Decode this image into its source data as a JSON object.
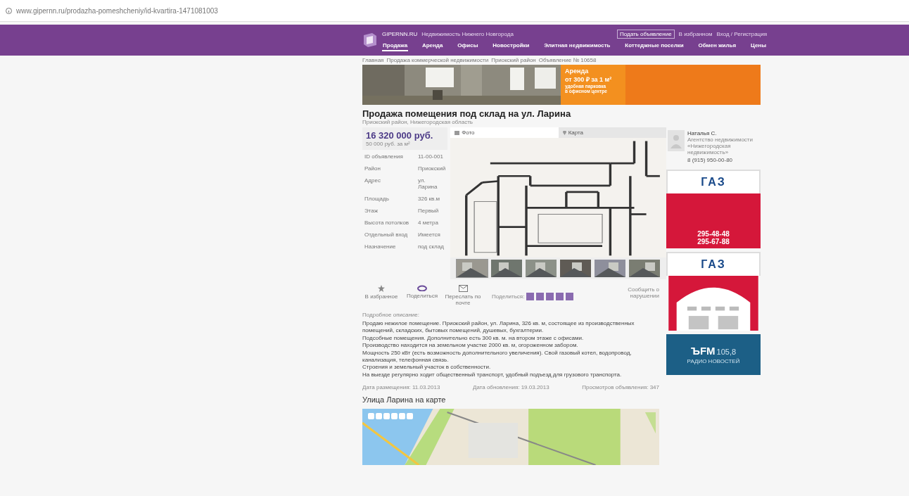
{
  "address_bar": {
    "url": "www.gipernn.ru/prodazha-pomeshcheniy/id-kvartira-1471081003"
  },
  "header": {
    "site_name": "GIPERNN.RU",
    "tagline": "Недвижимость Нижнего Новгорода",
    "post_button": "Подать объявление",
    "favorites": "В избранном",
    "login": "Вход / Регистрация",
    "nav": [
      {
        "label": "Продажа",
        "selected": true
      },
      {
        "label": "Аренда",
        "selected": false
      },
      {
        "label": "Офисы",
        "selected": false
      },
      {
        "label": "Новостройки",
        "selected": false
      },
      {
        "label": "Элитная недвижимость",
        "selected": false
      },
      {
        "label": "Коттеджные поселки",
        "selected": false
      },
      {
        "label": "Обмен жилья",
        "selected": false
      },
      {
        "label": "Цены",
        "selected": false
      }
    ]
  },
  "breadcrumbs": [
    "Главная",
    "Продажа коммерческой недвижимости",
    "Приокский район",
    "Объявление № 10658"
  ],
  "banner": {
    "lines": [
      "Аренда",
      "от 300 ₽ за 1 м²",
      "удобная парковка",
      "в офисном центре"
    ]
  },
  "listing": {
    "title": "Продажа помещения под склад на ул. Ларина",
    "subtitle": "Приокский район, Нижегородская область",
    "price": "16 320 000 руб.",
    "price_per_meter": "50 000 руб. за м²",
    "details": [
      {
        "label": "ID объявления",
        "value": "11-00-001"
      },
      {
        "label": "Район",
        "value": "Приокский"
      },
      {
        "label": "Адрес",
        "value": "ул. Ларина"
      },
      {
        "label": "Площадь",
        "value": "326 кв.м"
      },
      {
        "label": "Этаж",
        "value": "Первый"
      },
      {
        "label": "Высота потолков",
        "value": "4 метра"
      },
      {
        "label": "Отдельный вход",
        "value": "Имеется"
      },
      {
        "label": "Назначение",
        "value": "под склад"
      }
    ],
    "gallery_tabs": [
      {
        "label": "Фото",
        "selected": true
      },
      {
        "label": "Карта",
        "selected": false
      }
    ],
    "thumbnails": [
      {
        "selected": true
      },
      {
        "selected": false
      },
      {
        "selected": false
      },
      {
        "selected": false
      },
      {
        "selected": false
      },
      {
        "selected": false
      }
    ],
    "actions": [
      "В избранное",
      "Поделиться",
      "Переслать по почте"
    ],
    "share_label": "Поделиться:",
    "report": "Сообщить о нарушении",
    "description_heading": "Подробное описание:",
    "description": [
      "Продаю нежилое помещение. Приокский район, ул. Ларина, 326 кв. м, состоящее из производственных помещений, складских, бытовых помещений, душевых, бухгалтерии.",
      "Подсобные помещения. Дополнительно есть 300 кв. м. на втором этаже с офисами.",
      "Производство находится на земельном участке 2000 кв. м, огороженном забором.",
      "Мощность 250 кВт (есть возможность дополнительного увеличения). Свой газовый котел, водопровод,",
      "канализация, телефонная связь.",
      "Строения и земельный участок в собственности.",
      "На выезде регулярно ходит общественный транспорт, удобный подъезд для грузового транспорта."
    ],
    "posted": "Дата размещения: 11.03.2013",
    "updated": "Дата обновления: 19.03.2013",
    "views": "Просмотров объявления: 347",
    "map_heading": "Улица Ларина на карте"
  },
  "agent": {
    "name": "Наталья С.",
    "agency": "Агентство недвижимости «Нижегородская недвижимость»",
    "phone": "8 (915) 950-00-80"
  },
  "ads": [
    {
      "kind": "phones",
      "logo": "ГАЗ",
      "phones": [
        "295-48-48",
        "295-67-88"
      ]
    },
    {
      "kind": "arch",
      "logo": "ГАЗ"
    },
    {
      "kind": "radio",
      "logo": "ЪFM",
      "frequency": "105,8",
      "slogan": "РАДИО НОВОСТЕЙ"
    }
  ]
}
